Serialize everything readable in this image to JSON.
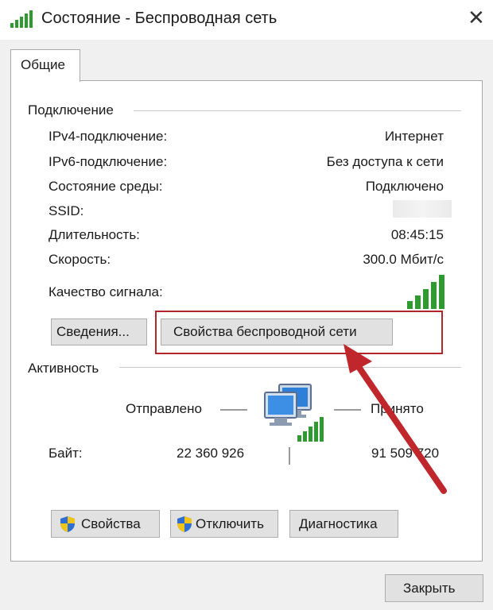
{
  "window": {
    "title": "Состояние - Беспроводная сеть",
    "close_glyph": "✕"
  },
  "tabs": [
    {
      "label": "Общие"
    }
  ],
  "connection": {
    "section_label": "Подключение",
    "rows": [
      {
        "label": "IPv4-подключение:",
        "value": "Интернет"
      },
      {
        "label": "IPv6-подключение:",
        "value": "Без доступа к сети"
      },
      {
        "label": "Состояние среды:",
        "value": "Подключено"
      },
      {
        "label": "SSID:",
        "value": ""
      },
      {
        "label": "Длительность:",
        "value": "08:45:15"
      },
      {
        "label": "Скорость:",
        "value": "300.0 Мбит/с"
      }
    ],
    "signal_label": "Качество сигнала:",
    "signal_bars_filled": 5,
    "signal_bars_total": 5,
    "details_button": "Сведения...",
    "wireless_props_button": "Свойства беспроводной сети"
  },
  "activity": {
    "section_label": "Активность",
    "sent_label": "Отправлено",
    "received_label": "Принято",
    "bytes_label": "Байт:",
    "bytes_sent": "22 360 926",
    "bytes_received": "91 509 720"
  },
  "actions": {
    "properties_button": "Свойства",
    "disable_button": "Отключить",
    "diagnostics_button": "Диагностика"
  },
  "footer": {
    "close_button": "Закрыть"
  },
  "colors": {
    "signal_green": "#2f9a2f",
    "annotation_red": "#b2262a",
    "shield_blue": "#2f6fd1",
    "shield_yellow": "#f0c419"
  },
  "icons": [
    "wifi-signal-icon",
    "close-icon",
    "network-computers-icon",
    "shield-icon"
  ]
}
